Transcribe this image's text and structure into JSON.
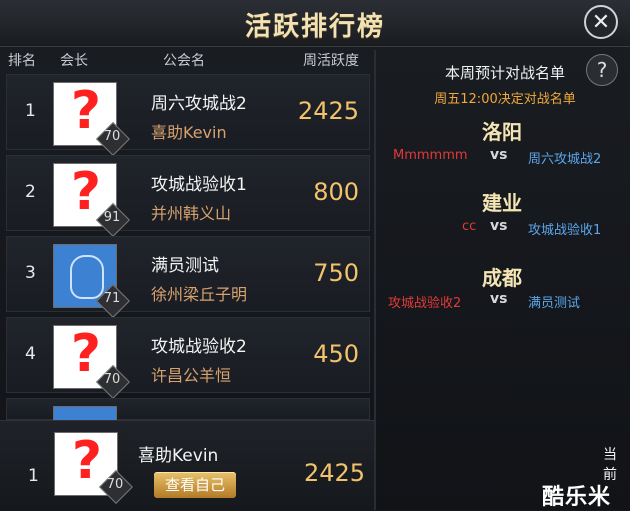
{
  "title": "活跃排行榜",
  "headers": {
    "rank": "排名",
    "leader": "会长",
    "guild": "公会名",
    "activity": "周活跃度"
  },
  "rows": [
    {
      "rank": "1",
      "level": "70",
      "guild": "周六攻城战2",
      "leader": "喜助Kevin",
      "score": "2425"
    },
    {
      "rank": "2",
      "level": "91",
      "guild": "攻城战验收1",
      "leader": "并州韩义山",
      "score": "800"
    },
    {
      "rank": "3",
      "level": "71",
      "guild": "满员测试",
      "leader": "徐州梁丘子明",
      "score": "750"
    },
    {
      "rank": "4",
      "level": "70",
      "guild": "攻城战验收2",
      "leader": "许昌公羊恒",
      "score": "450"
    }
  ],
  "matchups": {
    "title": "本周预计对战名单",
    "subtitle": "周五12:00决定对战名单",
    "vs": "vs",
    "items": [
      {
        "city": "洛阳",
        "left": "Mmmmmm",
        "right": "周六攻城战2"
      },
      {
        "city": "建业",
        "left": "cc",
        "right": "攻城战验收1"
      },
      {
        "city": "成都",
        "left": "攻城战验收2",
        "right": "满员测试"
      }
    ]
  },
  "self": {
    "rank": "1",
    "level": "70",
    "leader": "喜助Kevin",
    "button": "查看自己",
    "score": "2425"
  },
  "right_partial": "当前",
  "watermark": "酷乐米",
  "colors": {
    "gold": "#f2c36a",
    "red": "#e03a3a",
    "blue": "#5aa6ea"
  }
}
